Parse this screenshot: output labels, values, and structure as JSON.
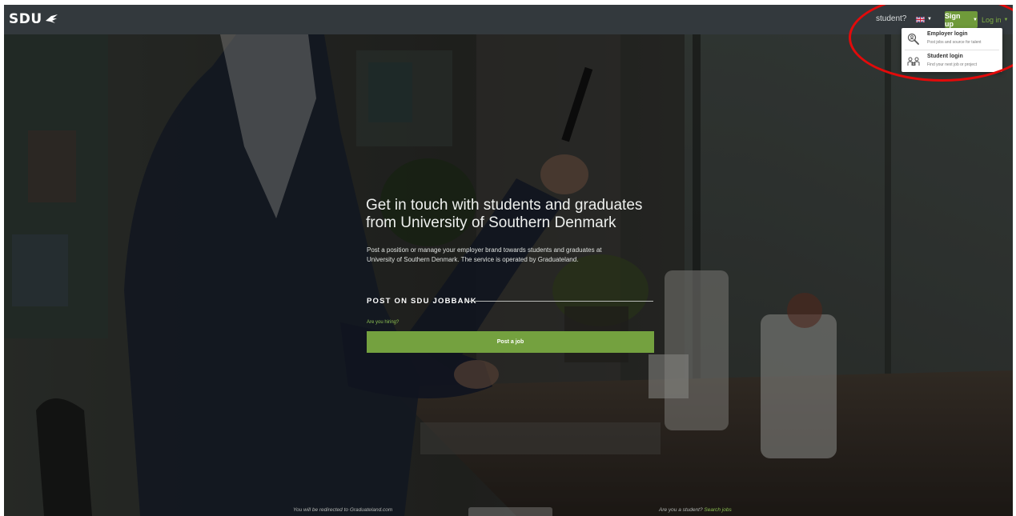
{
  "header": {
    "logo_text": "SDU",
    "student_link": "student?",
    "lang_icon": "uk-flag-icon",
    "signup_label": "Sign up",
    "login_label": "Log in",
    "signup_color": "#6f9a3a"
  },
  "login_dropdown": {
    "items": [
      {
        "title": "Employer login",
        "subtitle": "Post jobs and source for talent",
        "icon": "magnifier-person-icon"
      },
      {
        "title": "Student login",
        "subtitle": "Find your next job or project",
        "icon": "students-icon"
      }
    ]
  },
  "hero": {
    "headline_line1": "Get in touch with students and graduates",
    "headline_line2": "from University of Southern Denmark",
    "lead_line1": "Post a position or manage your employer brand towards students and graduates at",
    "lead_line2": "University of Southern Denmark. The service is operated by Graduateland.",
    "section_title": "POST ON SDU JOBBANK",
    "hiring_label": "Are you hiring?",
    "post_button": "Post a job",
    "accent_color": "#74a13f"
  },
  "footer": {
    "redirect_text": "You will be redirected to Graduateland.com",
    "student_question": "Are you a student?",
    "search_jobs_link": "Search jobs"
  }
}
